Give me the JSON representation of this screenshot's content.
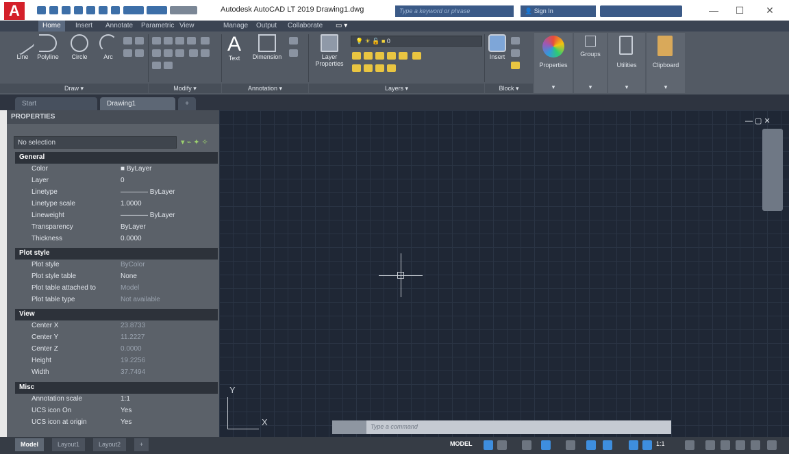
{
  "app": {
    "logo_letter": "A",
    "title": "Autodesk AutoCAD LT 2019    Drawing1.dwg",
    "search_placeholder": "Type a keyword or phrase",
    "sign_in": "Sign In",
    "window_controls": [
      "—",
      "☐",
      "✕"
    ]
  },
  "ribbon_tabs": [
    "Home",
    "Insert",
    "Annotate",
    "Parametric",
    "View",
    "Manage",
    "Output",
    "Collaborate"
  ],
  "ribbon": {
    "draw_tools": [
      "Line",
      "Polyline",
      "Circle",
      "Arc"
    ],
    "draw_label": "Draw ▾",
    "modify_label": "Modify ▾",
    "text_label": "Text",
    "dimension_label": "Dimension",
    "annotation_label": "Annotation ▾",
    "layer_props_label": "Layer Properties",
    "layers_label": "Layers ▾",
    "layer_current": "0",
    "insert_label": "Insert",
    "block_label": "Block ▾",
    "properties_label": "Properties",
    "groups_label": "Groups",
    "utilities_label": "Utilities",
    "clipboard_label": "Clipboard"
  },
  "doc_tabs": [
    "Start",
    "Drawing1"
  ],
  "palette": {
    "title": "PROPERTIES",
    "selection": "No selection",
    "sections": {
      "general": "General",
      "plot_style": "Plot style",
      "view": "View",
      "misc": "Misc"
    },
    "general_rows": [
      {
        "name": "Color",
        "value": "■ ByLayer"
      },
      {
        "name": "Layer",
        "value": "0"
      },
      {
        "name": "Linetype",
        "value": "———— ByLayer"
      },
      {
        "name": "Linetype scale",
        "value": "1.0000"
      },
      {
        "name": "Lineweight",
        "value": "———— ByLayer"
      },
      {
        "name": "Transparency",
        "value": "ByLayer"
      },
      {
        "name": "Thickness",
        "value": "0.0000"
      }
    ],
    "plot_rows": [
      {
        "name": "Plot style",
        "value": "ByColor"
      },
      {
        "name": "Plot style table",
        "value": "None"
      },
      {
        "name": "Plot table attached to",
        "value": "Model"
      },
      {
        "name": "Plot table type",
        "value": "Not available"
      }
    ],
    "view_rows": [
      {
        "name": "Center X",
        "value": "23.8733"
      },
      {
        "name": "Center Y",
        "value": "11.2227"
      },
      {
        "name": "Center Z",
        "value": "0.0000"
      },
      {
        "name": "Height",
        "value": "19.2256"
      },
      {
        "name": "Width",
        "value": "37.7494"
      }
    ],
    "misc_rows": [
      {
        "name": "Annotation scale",
        "value": "1:1"
      },
      {
        "name": "UCS icon On",
        "value": "Yes"
      },
      {
        "name": "UCS icon at origin",
        "value": "Yes"
      }
    ]
  },
  "canvas": {
    "controls": "— ▢ ✕",
    "ucs_x": "X",
    "ucs_y": "Y"
  },
  "command": {
    "placeholder": "Type a command"
  },
  "layout_tabs": [
    "Model",
    "Layout1",
    "Layout2",
    "+"
  ],
  "status": {
    "model": "MODEL",
    "scale": "1:1"
  }
}
